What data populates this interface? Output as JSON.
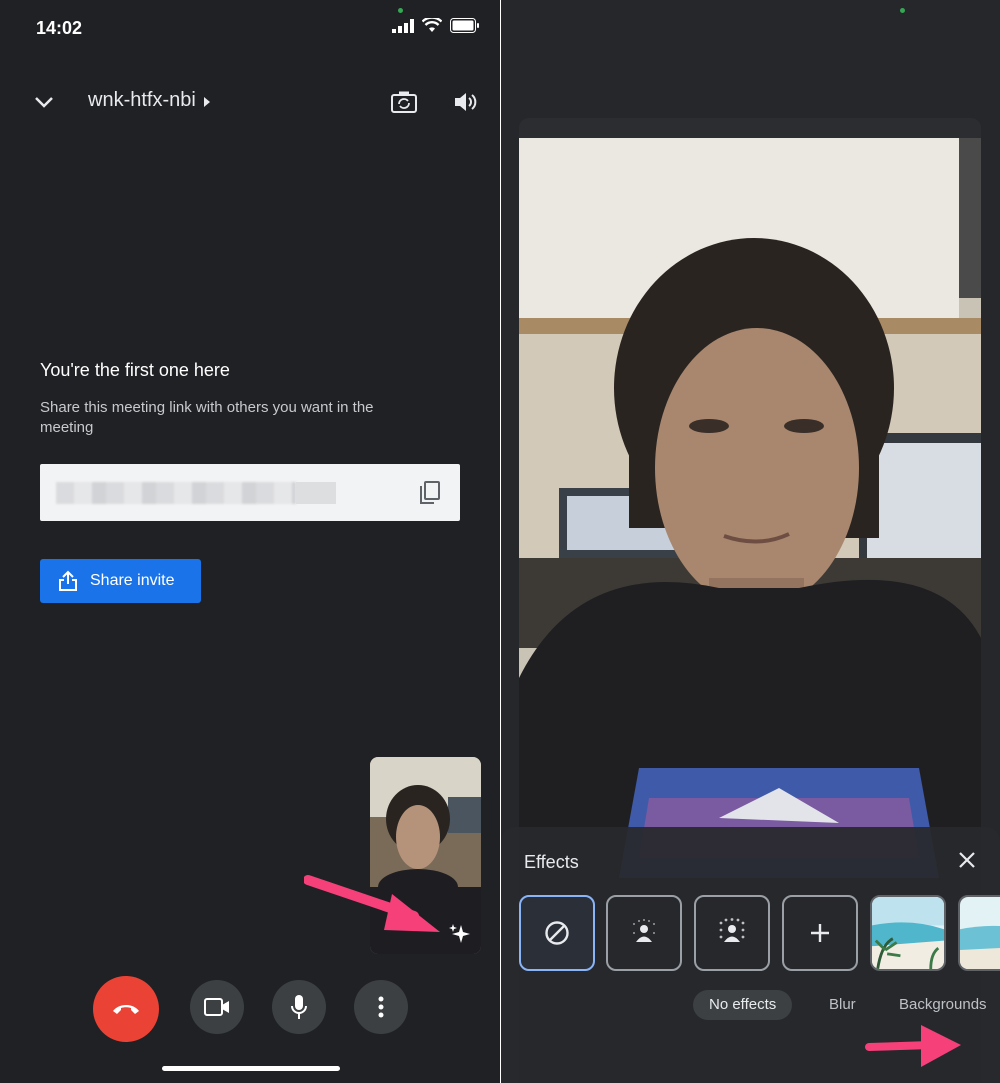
{
  "status_bar": {
    "time": "14:02"
  },
  "header": {
    "meeting_code": "wnk-htfx-nbi",
    "chevron_icon": "chevron-down-icon",
    "switch_camera_icon": "switch-camera-icon",
    "speaker_icon": "speaker-icon"
  },
  "lobby": {
    "title": "You're the first one here",
    "subtitle": "Share this meeting link with others you want in the meeting",
    "copy_icon": "copy-icon",
    "share_button_label": "Share invite"
  },
  "controls": {
    "end_call_icon": "end-call-icon",
    "camera_icon": "camera-icon",
    "mic_icon": "mic-icon",
    "more_icon": "more-vert-icon"
  },
  "effects": {
    "title": "Effects",
    "close_icon": "close-icon",
    "tiles": [
      {
        "icon": "no-effect-icon",
        "selected": true
      },
      {
        "icon": "slight-blur-icon",
        "selected": false
      },
      {
        "icon": "blur-icon",
        "selected": false
      },
      {
        "icon": "add-icon",
        "selected": false
      },
      {
        "icon": "beach-background-image",
        "selected": false
      },
      {
        "icon": "beach-background-image",
        "selected": false
      }
    ],
    "tabs": [
      {
        "label": "No effects",
        "active": true
      },
      {
        "label": "Blur",
        "active": false
      },
      {
        "label": "Backgrounds",
        "active": false
      }
    ]
  },
  "colors": {
    "background": "#202124",
    "share_button": "#1a73e8",
    "end_call": "#ea4335",
    "selected_tile": "#8ab4f8",
    "annotation_arrow": "#f5407a"
  }
}
